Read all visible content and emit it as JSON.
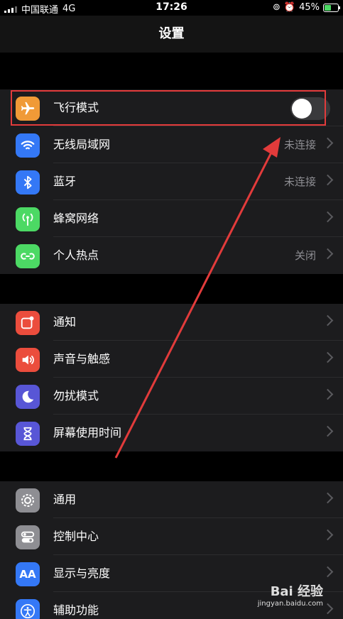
{
  "status": {
    "carrier": "中国联通",
    "network": "4G",
    "time": "17:26",
    "battery": "45%"
  },
  "nav": {
    "title": "设置"
  },
  "groups": [
    {
      "rows": [
        {
          "label": "飞行模式",
          "type": "toggle",
          "on": false,
          "icon": "airplane-icon",
          "color": "#f09a37"
        },
        {
          "label": "无线局域网",
          "value": "未连接",
          "icon": "wifi-icon",
          "color": "#3478f6"
        },
        {
          "label": "蓝牙",
          "value": "未连接",
          "icon": "bluetooth-icon",
          "color": "#3478f6"
        },
        {
          "label": "蜂窝网络",
          "value": "",
          "icon": "cellular-icon",
          "color": "#4cd964"
        },
        {
          "label": "个人热点",
          "value": "关闭",
          "icon": "hotspot-icon",
          "color": "#4cd964"
        }
      ]
    },
    {
      "rows": [
        {
          "label": "通知",
          "icon": "notifications-icon",
          "color": "#eb4d3d"
        },
        {
          "label": "声音与触感",
          "icon": "sound-icon",
          "color": "#eb4d3d"
        },
        {
          "label": "勿扰模式",
          "icon": "moon-icon",
          "color": "#5856d6"
        },
        {
          "label": "屏幕使用时间",
          "icon": "hourglass-icon",
          "color": "#5856d6"
        }
      ]
    },
    {
      "rows": [
        {
          "label": "通用",
          "icon": "gear-icon",
          "color": "#8e8e93"
        },
        {
          "label": "控制中心",
          "icon": "control-center-icon",
          "color": "#8e8e93"
        },
        {
          "label": "显示与亮度",
          "icon": "display-icon",
          "color": "#3478f6",
          "glyph": "AA"
        },
        {
          "label": "辅助功能",
          "icon": "accessibility-icon",
          "color": "#3478f6"
        }
      ]
    }
  ],
  "watermark": {
    "brand": "Bai 经验",
    "url": "jingyan.baidu.com"
  },
  "annotation": {
    "color": "#e23b3b"
  }
}
